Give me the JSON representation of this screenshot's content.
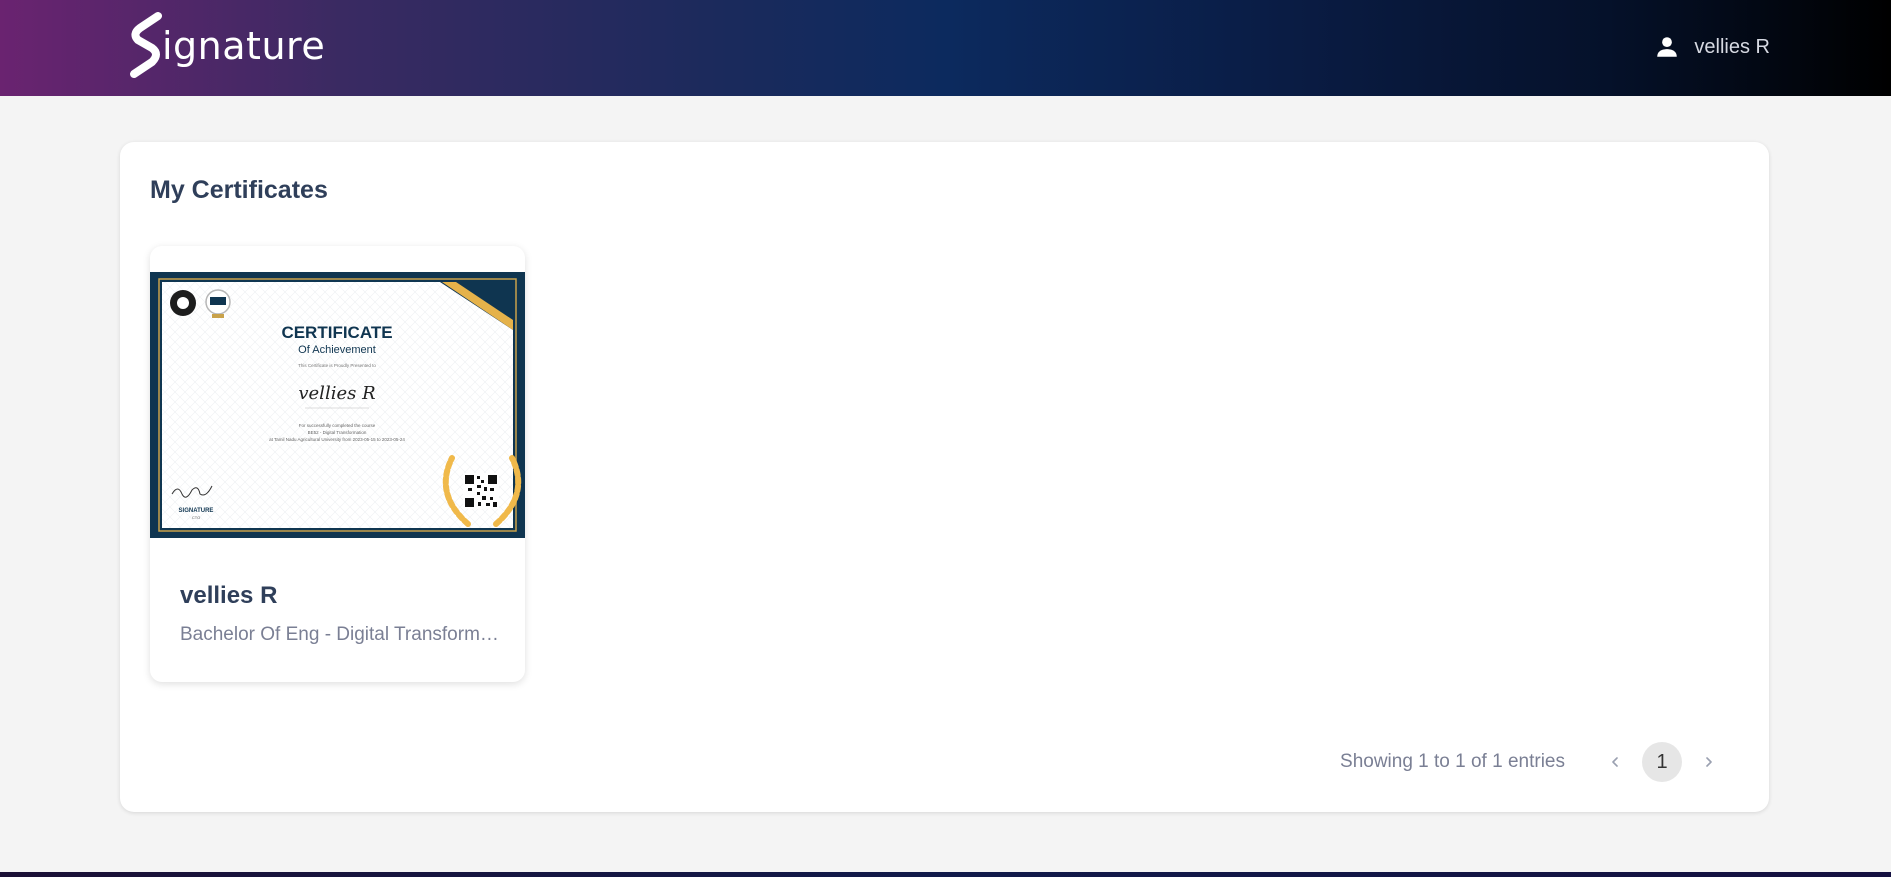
{
  "header": {
    "logo_text": "ignature",
    "user_name": "vellies R"
  },
  "main": {
    "title": "My Certificates",
    "certificates": [
      {
        "name": "vellies R",
        "course": "Bachelor Of Eng - Digital Transformation",
        "thumbnail": {
          "heading": "CERTIFICATE",
          "subheading": "Of Achievement",
          "presented_line": "This Certificate is Proudly Presented to",
          "recipient": "vellies R",
          "body_line1": "For successfully completed the course",
          "body_line2": "BE52 - Digital Transformation",
          "body_line3": "at Tamil Nadu Agricultural University from 2023-05-15 to 2023-05-24",
          "org_label": "SIGNATURE",
          "org_sub": "CTO"
        }
      }
    ],
    "pagination": {
      "info": "Showing 1 to 1 of 1 entries",
      "current_page": "1",
      "prev_icon": "chevron-left-icon",
      "next_icon": "chevron-right-icon"
    }
  },
  "colors": {
    "header_start": "#6a2370",
    "header_mid": "#0c2a5e",
    "header_end": "#000000",
    "cert_navy": "#0f3550",
    "cert_gold": "#e5b24a"
  }
}
